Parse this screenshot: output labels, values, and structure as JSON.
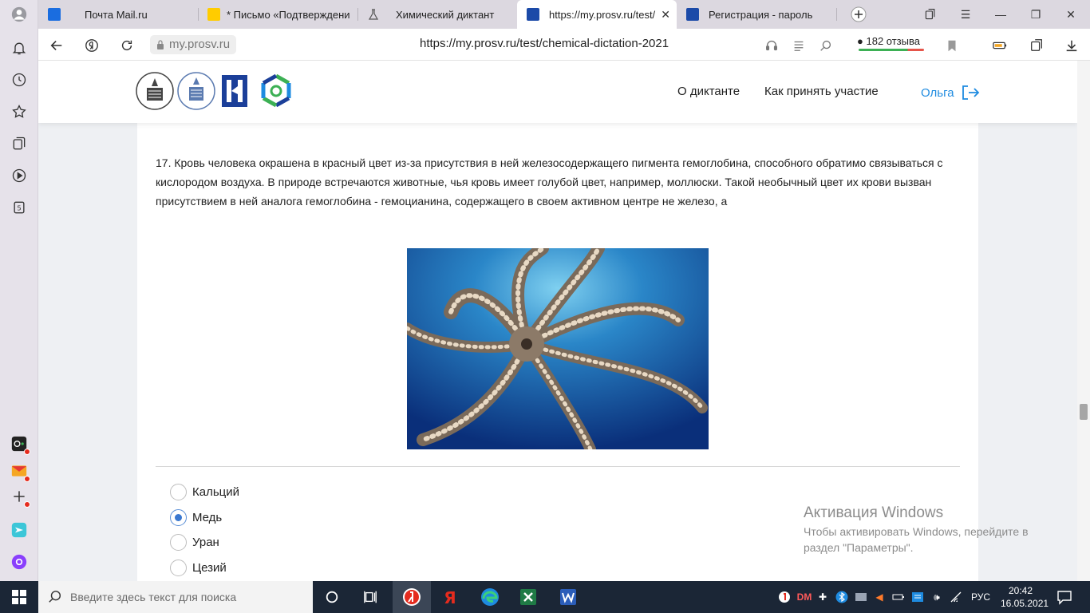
{
  "tabs": [
    {
      "title": "Почта Mail.ru"
    },
    {
      "title": "* Письмо «Подтверждени"
    },
    {
      "title": "Химический диктант"
    },
    {
      "title": "https://my.prosv.ru/test/"
    },
    {
      "title": "Регистрация - пароль"
    }
  ],
  "address": {
    "domain": "my.prosv.ru",
    "url": "https://my.prosv.ru/test/chemical-dictation-2021",
    "reviews": "182 отзыва"
  },
  "site": {
    "menu": [
      "О диктанте",
      "Как принять участие"
    ],
    "user": "Ольга"
  },
  "question": {
    "text": "17. Кровь человека окрашена в красный цвет из-за присутствия в ней железосодержащего пигмента гемоглобина, способного обратимо связываться с кислородом воздуха. В природе встречаются животные, чья кровь имеет голубой цвет, например, моллюски. Такой необычный цвет их крови вызван присутствием в ней аналога гемоглобина - гемоцианина, содержащего в своем активном центре не железо, а",
    "options": [
      {
        "label": "Кальций",
        "selected": false
      },
      {
        "label": "Медь",
        "selected": true
      },
      {
        "label": "Уран",
        "selected": false
      },
      {
        "label": "Цезий",
        "selected": false
      }
    ]
  },
  "watermark": {
    "title": "Активация Windows",
    "text": "Чтобы активировать Windows, перейдите в раздел \"Параметры\"."
  },
  "taskbar": {
    "search_placeholder": "Введите здесь текст для поиска",
    "lang": "РУС",
    "time": "20:42",
    "date": "16.05.2021"
  },
  "colors": {
    "accent": "#1e8be0",
    "taskbar": "#1b2636",
    "radio_selected": "#3a78d0"
  }
}
